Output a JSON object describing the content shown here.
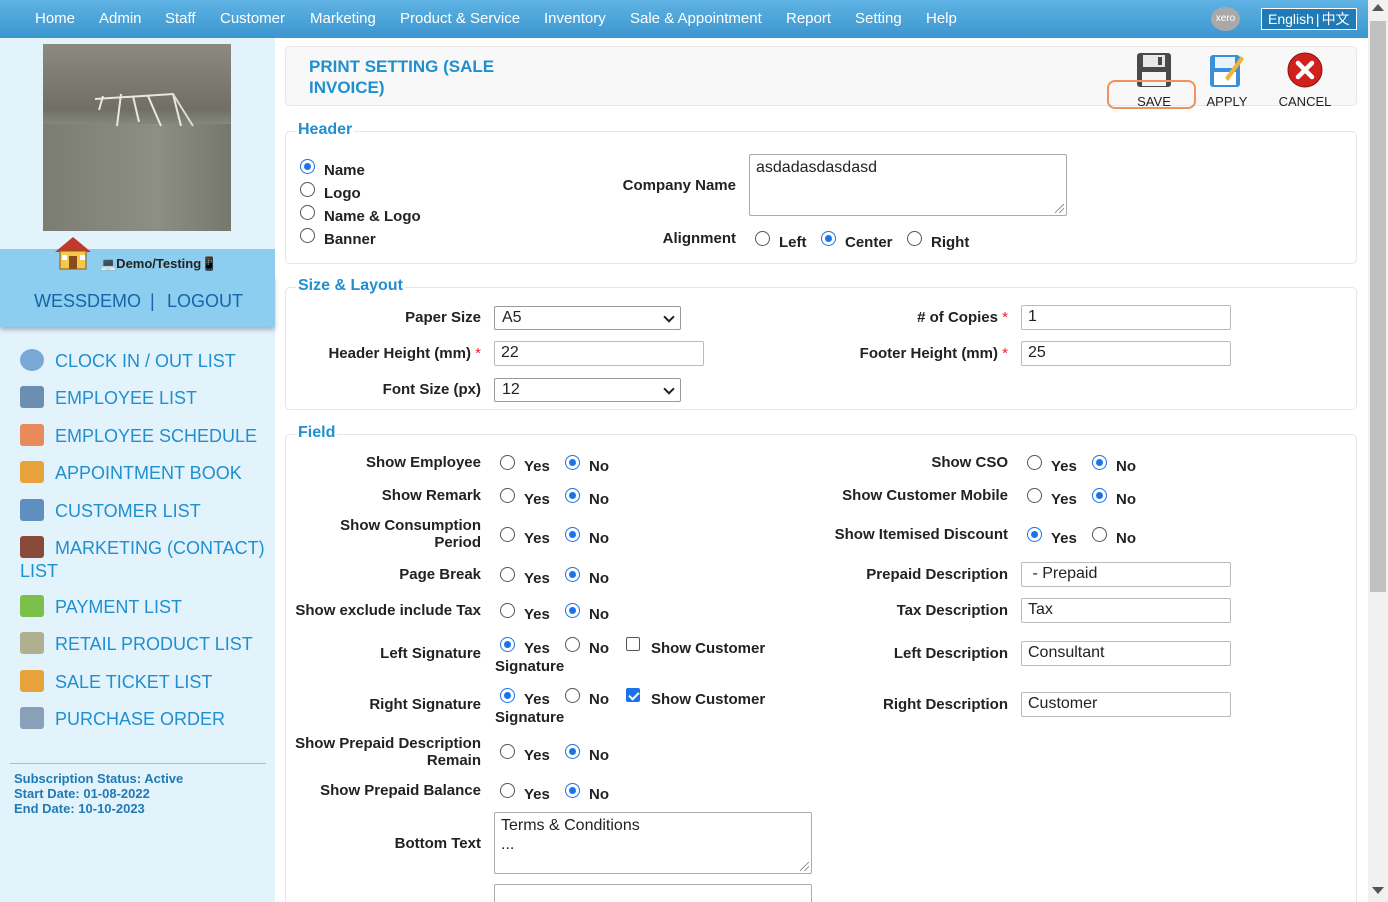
{
  "nav": {
    "items": [
      "Home",
      "Admin",
      "Staff",
      "Customer",
      "Marketing",
      "Product & Service",
      "Inventory",
      "Sale & Appointment",
      "Report",
      "Setting",
      "Help"
    ],
    "xero_label": "xero",
    "lang_english": "English",
    "lang_sep": "|",
    "lang_chinese": "中文"
  },
  "sidebar": {
    "demo_label": "💻Demo/Testing📱",
    "user": "WESSDEMO",
    "user_sep": "|",
    "logout": "LOGOUT",
    "menu": [
      {
        "label": "CLOCK IN / OUT LIST",
        "icon": "clock-icon",
        "color": "#7aa9d6"
      },
      {
        "label": "EMPLOYEE LIST",
        "icon": "employee-list-icon",
        "color": "#6b8fb3"
      },
      {
        "label": "EMPLOYEE SCHEDULE",
        "icon": "schedule-icon",
        "color": "#e88a5a"
      },
      {
        "label": "APPOINTMENT BOOK",
        "icon": "appointment-icon",
        "color": "#e8a23c"
      },
      {
        "label": "CUSTOMER LIST",
        "icon": "customer-list-icon",
        "color": "#5f8fbf"
      },
      {
        "label": "MARKETING (CONTACT) LIST",
        "icon": "marketing-icon",
        "color": "#8a4a3a"
      },
      {
        "label": "PAYMENT LIST",
        "icon": "payment-icon",
        "color": "#7cbf4a"
      },
      {
        "label": "RETAIL PRODUCT LIST",
        "icon": "retail-product-icon",
        "color": "#b0b090"
      },
      {
        "label": "SALE TICKET LIST",
        "icon": "sale-ticket-icon",
        "color": "#e8a23c"
      },
      {
        "label": "PURCHASE ORDER",
        "icon": "purchase-order-icon",
        "color": "#8aa0b8"
      }
    ],
    "subscription": {
      "status": "Subscription Status: Active",
      "start": "Start Date: 01-08-2022",
      "end": "End Date: 10-10-2023"
    }
  },
  "page": {
    "title_line1": "PRINT SETTING (SALE",
    "title_line2": "INVOICE)",
    "save": "SAVE",
    "apply": "APPLY",
    "cancel": "CANCEL"
  },
  "header_section": {
    "label": "Header",
    "type_options": [
      {
        "label": "Name",
        "selected": true
      },
      {
        "label": "Logo",
        "selected": false
      },
      {
        "label": "Name & Logo",
        "selected": false
      },
      {
        "label": "Banner",
        "selected": false
      }
    ],
    "company_name_label": "Company Name",
    "company_name_value": "asdadasdasdasd",
    "alignment_label": "Alignment",
    "alignment_options": [
      {
        "label": "Left",
        "selected": false
      },
      {
        "label": "Center",
        "selected": true
      },
      {
        "label": "Right",
        "selected": false
      }
    ]
  },
  "size_layout": {
    "label": "Size & Layout",
    "paper_size_label": "Paper Size",
    "paper_size_value": "A5",
    "copies_label": "# of Copies",
    "copies_value": "1",
    "header_height_label": "Header Height (mm)",
    "header_height_value": "22",
    "footer_height_label": "Footer Height (mm)",
    "footer_height_value": "25",
    "font_size_label": "Font Size (px)",
    "font_size_value": "12",
    "required_mark": "*"
  },
  "field_section": {
    "label": "Field",
    "yes": "Yes",
    "no": "No",
    "show_customer": "Show Customer",
    "signature": "Signature",
    "left_fields": [
      {
        "label": "Show Employee",
        "value": "No"
      },
      {
        "label": "Show Remark",
        "value": "No"
      },
      {
        "label": "Show Consumption",
        "label2": "Period",
        "value": "No"
      },
      {
        "label": "Page Break",
        "value": "No"
      },
      {
        "label": "Show exclude include Tax",
        "value": "No"
      },
      {
        "label": "Left Signature",
        "value": "Yes",
        "show_customer_signature": false
      },
      {
        "label": "Right Signature",
        "value": "Yes",
        "show_customer_signature": true
      },
      {
        "label": "Show Prepaid Description",
        "label2": "Remain",
        "value": "No"
      },
      {
        "label": "Show Prepaid Balance",
        "value": "No"
      }
    ],
    "right_radio_fields": [
      {
        "label": "Show CSO",
        "value": "No"
      },
      {
        "label": "Show Customer Mobile",
        "value": "No"
      },
      {
        "label": "Show Itemised Discount",
        "value": "Yes"
      }
    ],
    "right_text_fields": [
      {
        "label": "Prepaid Description",
        "value": " - Prepaid"
      },
      {
        "label": "Tax Description",
        "value": "Tax"
      },
      {
        "label": "Left Description",
        "value": "Consultant"
      },
      {
        "label": "Right Description",
        "value": "Customer"
      }
    ],
    "bottom_text_label": "Bottom Text",
    "bottom_text_line1": "Terms & Conditions",
    "bottom_text_line2": "..."
  }
}
